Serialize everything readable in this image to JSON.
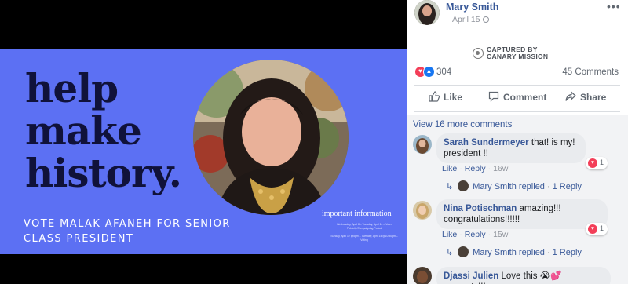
{
  "poster": {
    "headline": [
      "help",
      "make",
      "history."
    ],
    "vote_lines": [
      "VOTE MALAK AFANEH FOR SENIOR",
      "CLASS PRESIDENT"
    ],
    "info_title": "important information",
    "info_lines": [
      "Wednesday, April 8 – Tuesday, April 14 – Voter",
      "Publicity/Campaigning Period",
      "",
      "Sunday, April 12 @5pm – Tuesday, April 14 @10:30pm –",
      "Voting"
    ],
    "colors": {
      "background": "#5c70f3",
      "headline": "#10123a",
      "text": "#ffffff"
    }
  },
  "post": {
    "author": "Mary Smith",
    "date": "April 15",
    "privacy_icon": "globe-icon",
    "more_icon": "more-dots-icon",
    "watermark": {
      "line1": "CAPTURED BY",
      "line2": "CANARY MISSION"
    },
    "reaction_count": "304",
    "comments_count": "45 Comments",
    "actions": [
      {
        "label": "Like",
        "icon": "thumbs-up-icon"
      },
      {
        "label": "Comment",
        "icon": "comment-icon"
      },
      {
        "label": "Share",
        "icon": "share-icon"
      }
    ],
    "accent": "#385898"
  },
  "comments_section": {
    "view_more": "View 16 more comments",
    "comments": [
      {
        "name": "Sarah Sundermeyer",
        "text": "that! is my! president !!",
        "like": "Like",
        "reply": "Reply",
        "time": "16w",
        "reaction_count": "1",
        "replies": {
          "name": "Mary Smith",
          "label": "replied",
          "count": "1 Reply"
        }
      },
      {
        "name": "Nina Potischman",
        "text": "amazing!!! congratulations!!!!!!",
        "like": "Like",
        "reply": "Reply",
        "time": "15w",
        "reaction_count": "1",
        "replies": {
          "name": "Mary Smith",
          "label": "replied",
          "count": "1 Reply"
        }
      },
      {
        "name": "Djassi Julien",
        "text": "Love this 😭💕 congrats!!!"
      }
    ]
  }
}
